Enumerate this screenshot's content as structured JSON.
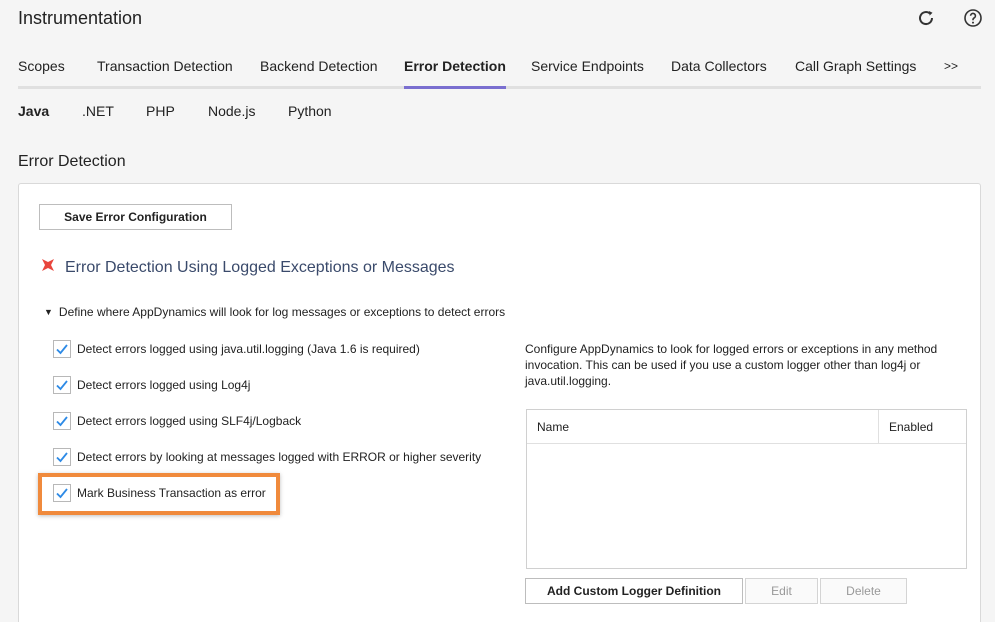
{
  "app": {
    "title": "Instrumentation"
  },
  "header_icons": {
    "refresh": "refresh-icon",
    "help": "help-icon"
  },
  "tabs": [
    {
      "label": "Scopes"
    },
    {
      "label": "Transaction Detection"
    },
    {
      "label": "Backend Detection"
    },
    {
      "label": "Error Detection",
      "active": true
    },
    {
      "label": "Service Endpoints"
    },
    {
      "label": "Data Collectors"
    },
    {
      "label": "Call Graph Settings"
    },
    {
      "label": ">>"
    }
  ],
  "subtabs": [
    {
      "label": "Java",
      "active": true
    },
    {
      "label": ".NET"
    },
    {
      "label": "PHP"
    },
    {
      "label": "Node.js"
    },
    {
      "label": "Python"
    }
  ],
  "section": {
    "title": "Error Detection",
    "save_button": "Save Error Configuration",
    "heading": "Error Detection Using Logged Exceptions or Messages",
    "define_text": "Define where AppDynamics will look for log messages or exceptions to detect errors",
    "checkboxes": [
      {
        "label": "Detect errors logged using java.util.logging (Java 1.6 is required)",
        "checked": true
      },
      {
        "label": "Detect errors logged using Log4j",
        "checked": true
      },
      {
        "label": "Detect errors logged using SLF4j/Logback",
        "checked": true
      },
      {
        "label": "Detect errors by looking at messages logged with ERROR or higher severity",
        "checked": true
      },
      {
        "label": "Mark Business Transaction as error",
        "checked": true
      }
    ],
    "custom_logger": {
      "description": "Configure AppDynamics to look for logged errors or exceptions in any method invocation. This can be used if you use a custom logger other than log4j or java.util.logging.",
      "columns": [
        "Name",
        "Enabled"
      ],
      "rows": [],
      "add_button": "Add Custom Logger Definition",
      "edit_button": "Edit",
      "delete_button": "Delete"
    }
  },
  "colors": {
    "accent": "#7a6fd0",
    "highlight": "#f08a3c",
    "heading": "#3a4a6b",
    "check": "#2d8ae6",
    "error_icon": "#e8453c"
  }
}
